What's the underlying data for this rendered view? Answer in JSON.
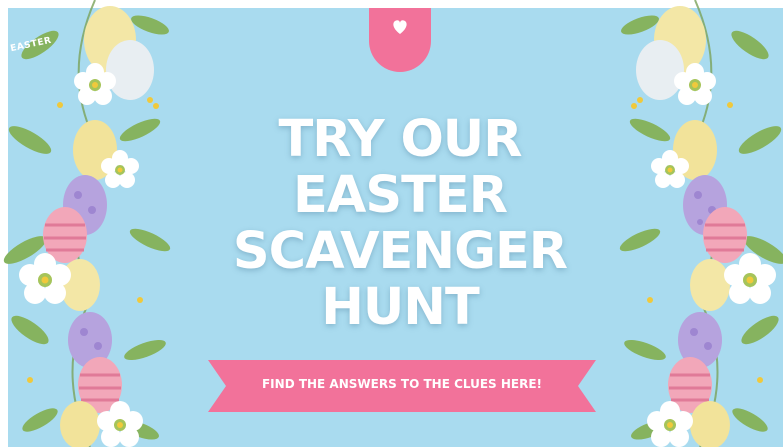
{
  "tag": {
    "label": "EASTER",
    "icon": "heart-icon"
  },
  "headline": {
    "line1": "TRY OUR",
    "line2": "EASTER",
    "line3": "SCAVENGER",
    "line4": "HUNT"
  },
  "ribbon": {
    "label": "FIND THE ANSWERS TO THE CLUES HERE!"
  },
  "colors": {
    "background": "#a9dbef",
    "pink": "#f2729a",
    "white": "#ffffff"
  },
  "decor": {
    "left": "easter-egg-flower-garland",
    "right": "easter-egg-flower-garland"
  }
}
